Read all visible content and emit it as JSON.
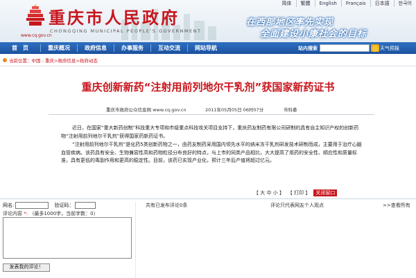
{
  "header": {
    "title": "重庆市人民政府",
    "subtitle": "CHONGQING MUNICIPAL PEOPLE'S GOVERNMENT",
    "url": "www.cq.gov.cn",
    "slogan_line1": "在西部地区率先实现",
    "slogan_line2": "全面建设小康社会的目标",
    "languages": [
      "简体",
      "繁體",
      "English",
      "Français",
      "日本語",
      "한국어"
    ]
  },
  "nav": {
    "items": [
      "首页",
      "重庆概况",
      "政府信息",
      "办事服务",
      "互动交流",
      "网站导航"
    ],
    "search_label": "站内搜索",
    "search_placeholder": "",
    "weather_label": "天气预报"
  },
  "breadcrumb": "当前位置：中国 - 重庆>政府信息>政府动态",
  "article": {
    "title": "重庆创新新药“注射用前列地尔干乳剂”获国家新药证书",
    "source": "重庆市政府公众信息网 www.cq.gov.cn",
    "date": "2011年05月05日 06时07分",
    "author": "市科委",
    "paragraphs": [
      "近日，在国家“重大新药创制”科技重大专项和市级重点科技攻关项目支持下，重庆药友制药有限公司研制的具有自主知识产权的创新药物“注射用前列地尔干乳剂”获得国家药新药证书。",
      "“注射用前列地尔干乳剂”是化药5类创新药物之一，由药友制药采用国内领先水平的纳米冻干乳剂研发技术研制而成，主要用于治疗心脑血管疾病。该药具有安全、生物兼容性高和药物粒径分布良好的特点，与上市的同类产品相比，大大提高了用药的安全性、顺应性和质量标准，具有更低的毒副作用和更高的稳定性。目前，该药已实现产业化，预计三年后产值将超过亿元。"
    ]
  },
  "tools": {
    "size_label": "【 大  中  小 】",
    "print_label": "【 打印 】",
    "close_label": "关闭窗口"
  },
  "comment": {
    "name_label": "网名:",
    "code_label": "验证码：",
    "content_label": "评论内容",
    "required_mark": "*:",
    "limit_text": "（最多1000字，当前字数：0）",
    "submit_label": "发表我的评论！",
    "count_text": "共有已发布评论0条",
    "note_text": "评论只代表网友个人观点",
    "more_text": ">>查看所有"
  },
  "colors": {
    "brand_red": "#c8161d",
    "nav_blue": "#1c52a0"
  }
}
